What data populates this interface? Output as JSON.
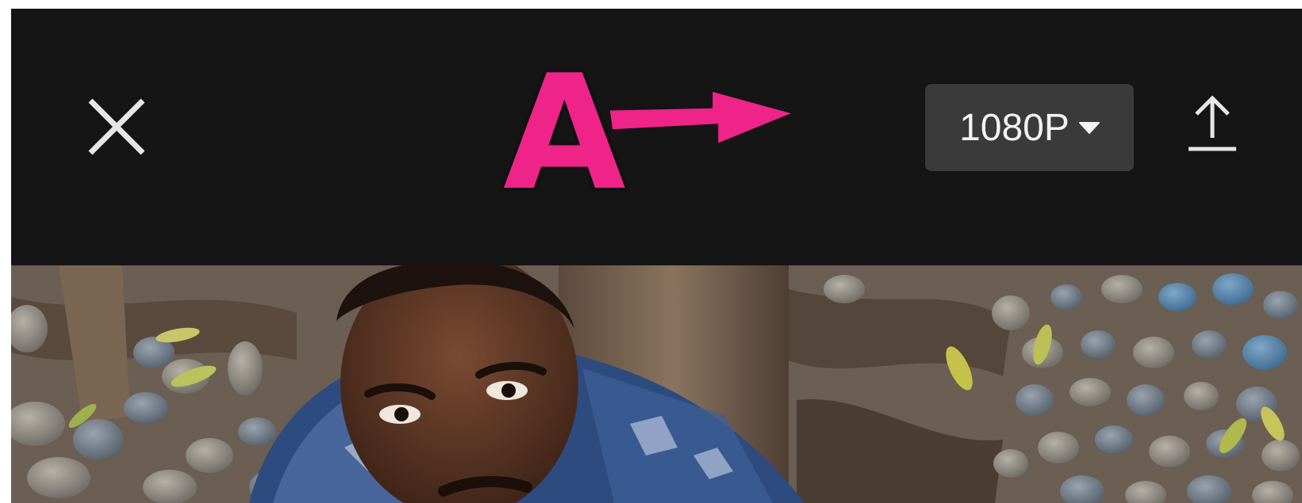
{
  "toolbar": {
    "close_icon": "close-icon",
    "resolution_label": "1080P",
    "resolution_caret_icon": "caret-down-icon",
    "export_icon": "upload-icon"
  },
  "annotation": {
    "letter": "A",
    "color": "#ef2489",
    "arrow_icon": "arrow-right-icon"
  },
  "colors": {
    "toolbar_bg": "#151515",
    "button_bg": "#3a3a3a",
    "icon": "#e6e6e6"
  },
  "photo": {
    "subject": "photo-preview"
  }
}
